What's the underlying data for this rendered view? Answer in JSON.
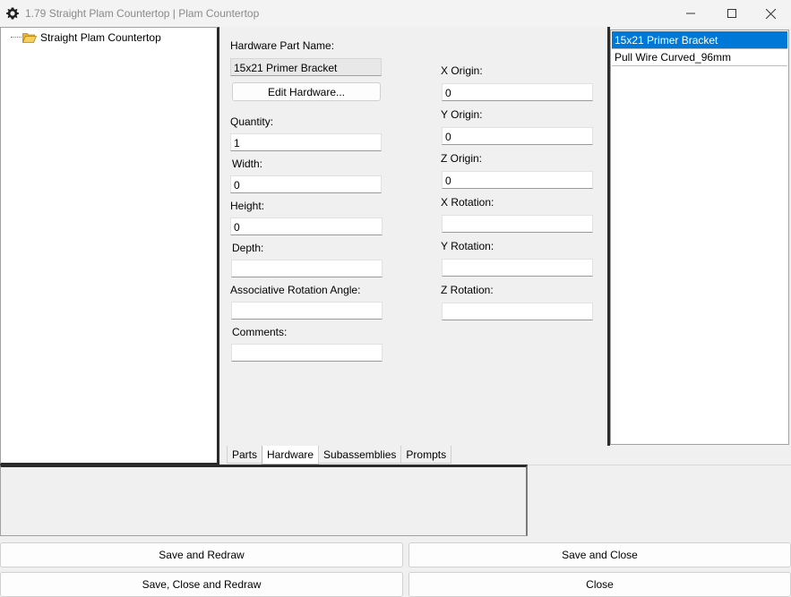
{
  "window": {
    "title": "1.79 Straight Plam Countertop | Plam Countertop",
    "app_icon": "gear-icon",
    "controls": [
      "minimize-icon",
      "maximize-icon",
      "close-icon"
    ]
  },
  "tree": {
    "items": [
      {
        "label": "Straight Plam Countertop",
        "icon": "folder-open-icon"
      }
    ]
  },
  "form": {
    "hardware_part_name_label": "Hardware Part Name:",
    "hardware_part_name_value": "15x21 Primer Bracket",
    "edit_hardware_button": "Edit Hardware...",
    "quantity_label": "Quantity:",
    "quantity_value": "1",
    "width_label": "Width:",
    "width_value": "0",
    "height_label": "Height:",
    "height_value": "0",
    "depth_label": "Depth:",
    "depth_value": "",
    "assoc_rotation_label": "Associative Rotation Angle:",
    "assoc_rotation_value": "",
    "comments_label": "Comments:",
    "comments_value": "",
    "x_origin_label": "X Origin:",
    "x_origin_value": "0",
    "y_origin_label": "Y Origin:",
    "y_origin_value": "0",
    "z_origin_label": "Z Origin:",
    "z_origin_value": "0",
    "x_rotation_label": "X Rotation:",
    "x_rotation_value": "",
    "y_rotation_label": "Y Rotation:",
    "y_rotation_value": "",
    "z_rotation_label": "Z Rotation:",
    "z_rotation_value": ""
  },
  "hardware_list": {
    "items": [
      {
        "label": "15x21 Primer Bracket",
        "selected": true
      },
      {
        "label": "Pull Wire Curved_96mm",
        "selected": false
      }
    ]
  },
  "tabs": [
    {
      "label": "Parts",
      "active": false
    },
    {
      "label": "Hardware",
      "active": true
    },
    {
      "label": "Subassemblies",
      "active": false
    },
    {
      "label": "Prompts",
      "active": false
    }
  ],
  "actions": {
    "save_and_redraw": "Save and Redraw",
    "save_and_close": "Save and Close",
    "save_close_and_redraw": "Save, Close and Redraw",
    "close": "Close"
  },
  "colors": {
    "selection": "#0078d7",
    "panel_border": "#2b2b2b",
    "background": "#f0f0f0"
  }
}
